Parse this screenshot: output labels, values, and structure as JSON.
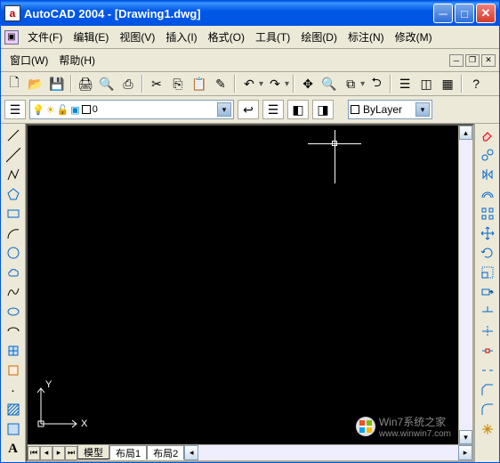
{
  "title": "AutoCAD 2004 - [Drawing1.dwg]",
  "menus": {
    "file": "文件(F)",
    "edit": "编辑(E)",
    "view": "视图(V)",
    "insert": "插入(I)",
    "format": "格式(O)",
    "tools": "工具(T)",
    "draw": "绘图(D)",
    "dim": "标注(N)",
    "modify": "修改(M)",
    "window": "窗口(W)",
    "help": "帮助(H)"
  },
  "layer": {
    "current": "0",
    "bylayer": "ByLayer"
  },
  "tabs": {
    "model": "模型",
    "layout1": "布局1",
    "layout2": "布局2"
  },
  "axes": {
    "x": "X",
    "y": "Y"
  },
  "watermark": {
    "line1": "Win7系统之家",
    "line2": "www.winwin7.com"
  },
  "icons": {
    "new": "🗋",
    "open": "📂",
    "save": "💾",
    "print": "🖨",
    "preview": "🔍",
    "cut": "✂",
    "copy": "⎘",
    "paste": "📋",
    "match": "✎",
    "undo": "↶",
    "redo": "↷",
    "pan": "✥",
    "zoom_rt": "🔍",
    "zoom_wnd": "⧉",
    "zoom_prev": "⮌",
    "props": "☰",
    "help": "?",
    "layer_mgr": "☰",
    "layer_prev": "↩",
    "lt1": "☰",
    "lt2": "◧",
    "lt3": "◨",
    "bl_sq": "■"
  },
  "draw_tools": [
    "line",
    "cline",
    "pline",
    "polygon",
    "rect",
    "arc",
    "circle",
    "revcloud",
    "spline",
    "ellipse",
    "ellipsearc",
    "block",
    "point",
    "hatch",
    "region",
    "table",
    "text"
  ],
  "modify_tools": [
    "erase",
    "copy",
    "mirror",
    "offset",
    "array",
    "move",
    "rotate",
    "scale",
    "stretch",
    "trim",
    "extend",
    "break",
    "chamfer",
    "fillet",
    "explode"
  ]
}
